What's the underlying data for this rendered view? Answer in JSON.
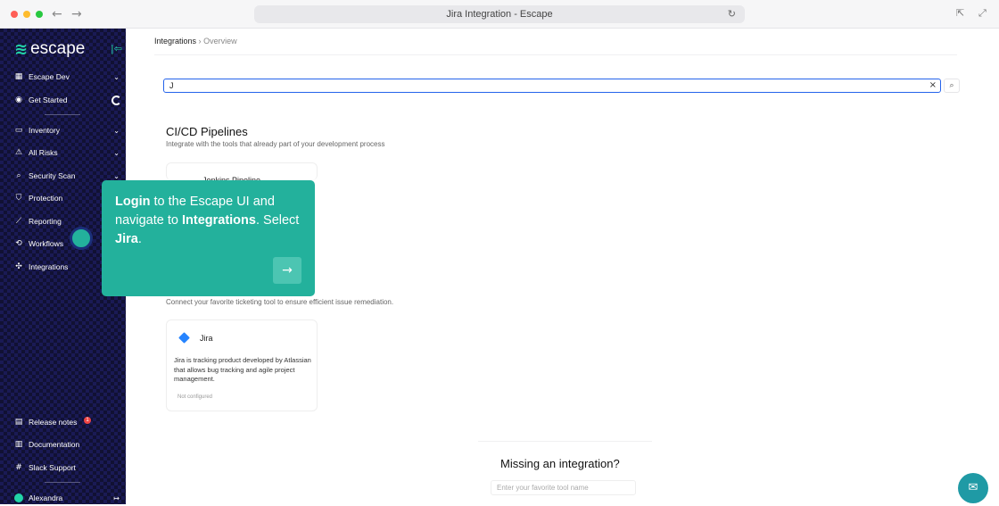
{
  "browser": {
    "url_title": "Jira Integration - Escape",
    "colors": {
      "red": "#ff5f57",
      "yellow": "#febc2e",
      "green": "#28c840"
    }
  },
  "sidebar": {
    "logo": "escape",
    "items": [
      {
        "label": "Escape Dev",
        "icon": "building-icon"
      },
      {
        "label": "Get Started",
        "icon": "rocket-icon"
      },
      {
        "label": "Inventory",
        "icon": "window-icon"
      },
      {
        "label": "All Risks",
        "icon": "warning-icon"
      },
      {
        "label": "Security Scan",
        "icon": "search-icon"
      },
      {
        "label": "Protection",
        "icon": "shield-icon"
      },
      {
        "label": "Reporting",
        "icon": "chart-icon"
      },
      {
        "label": "Workflows",
        "icon": "workflow-icon"
      },
      {
        "label": "Integrations",
        "icon": "integration-icon"
      }
    ],
    "bottom": [
      {
        "label": "Release notes",
        "icon": "news-icon",
        "badge": "1"
      },
      {
        "label": "Documentation",
        "icon": "book-icon"
      },
      {
        "label": "Slack Support",
        "icon": "slack-icon"
      }
    ],
    "user": "Alexandra"
  },
  "main": {
    "breadcrumb": {
      "root": "Integrations",
      "sep": "›",
      "current": "Overview"
    },
    "search": {
      "value": "J"
    },
    "cicd": {
      "title": "CI/CD Pipelines",
      "subtitle": "Integrate with the tools that already part of your development process",
      "card_title": "Jenkins Pipeline"
    },
    "ticketing": {
      "subtitle": "Connect your favorite ticketing tool to ensure efficient issue remediation.",
      "card_title": "Jira",
      "card_desc": "Jira is tracking product developed by Atlassian that allows bug tracking and agile project management.",
      "card_status": "Not configured"
    },
    "missing": {
      "title": "Missing an integration?",
      "placeholder": "Enter your favorite tool name"
    }
  },
  "tooltip": {
    "w1": "Login",
    "t1": " to the Escape UI and navigate to ",
    "w2": "Integrations",
    "t2": ". Select ",
    "w3": "Jira",
    "t3": "."
  },
  "accent": "#23b19c"
}
